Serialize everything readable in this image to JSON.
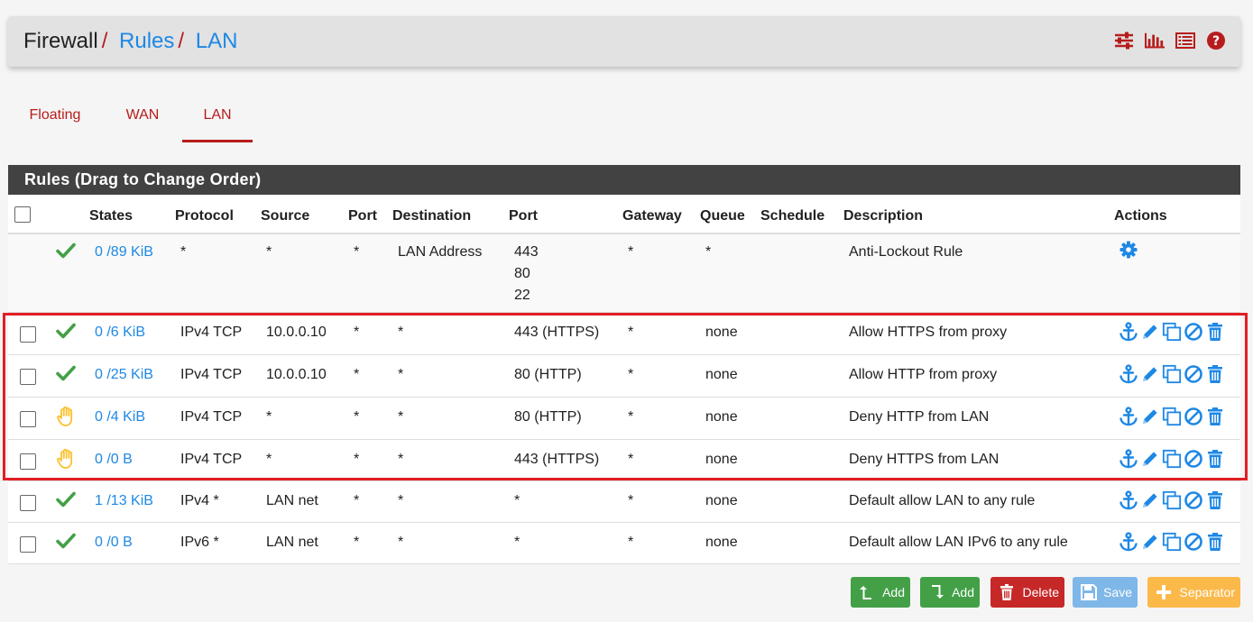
{
  "header": {
    "crumbs": [
      "Firewall",
      "Rules",
      "LAN"
    ],
    "separator": "/",
    "icons": [
      "sliders-icon",
      "bar-chart-icon",
      "list-icon",
      "help-icon"
    ]
  },
  "tabs": [
    "Floating",
    "WAN",
    "LAN"
  ],
  "active_tab": "LAN",
  "panel": {
    "title": "Rules (Drag to Change Order)"
  },
  "columns": [
    "States",
    "Protocol",
    "Source",
    "Port",
    "Destination",
    "Port",
    "Gateway",
    "Queue",
    "Schedule",
    "Description",
    "Actions"
  ],
  "rows": [
    {
      "status": "check",
      "states": "0 /89 KiB",
      "protocol": "*",
      "source": "*",
      "sport": "*",
      "destination": "LAN Address",
      "dport": [
        "443",
        "80",
        "22"
      ],
      "gateway": "*",
      "queue": "*",
      "schedule": "",
      "description": "Anti-Lockout Rule"
    },
    {
      "status": "check",
      "states": "0 /6 KiB",
      "protocol": "IPv4 TCP",
      "source": "10.0.0.10",
      "sport": "*",
      "destination": "*",
      "dport": [
        "443 (HTTPS)"
      ],
      "gateway": "*",
      "queue": "none",
      "schedule": "",
      "description": "Allow HTTPS from proxy"
    },
    {
      "status": "check",
      "states": "0 /25 KiB",
      "protocol": "IPv4 TCP",
      "source": "10.0.0.10",
      "sport": "*",
      "destination": "*",
      "dport": [
        "80 (HTTP)"
      ],
      "gateway": "*",
      "queue": "none",
      "schedule": "",
      "description": "Allow HTTP from proxy"
    },
    {
      "status": "hand",
      "states": "0 /4 KiB",
      "protocol": "IPv4 TCP",
      "source": "*",
      "sport": "*",
      "destination": "*",
      "dport": [
        "80 (HTTP)"
      ],
      "gateway": "*",
      "queue": "none",
      "schedule": "",
      "description": "Deny HTTP from LAN"
    },
    {
      "status": "hand",
      "states": "0 /0 B",
      "protocol": "IPv4 TCP",
      "source": "*",
      "sport": "*",
      "destination": "*",
      "dport": [
        "443 (HTTPS)"
      ],
      "gateway": "*",
      "queue": "none",
      "schedule": "",
      "description": "Deny HTTPS from LAN"
    },
    {
      "status": "check",
      "states": "1 /13 KiB",
      "protocol": "IPv4 *",
      "source": "LAN net",
      "sport": "*",
      "destination": "*",
      "dport": [
        "*"
      ],
      "gateway": "*",
      "queue": "none",
      "schedule": "",
      "description": "Default allow LAN to any rule"
    },
    {
      "status": "check",
      "states": "0 /0 B",
      "protocol": "IPv6 *",
      "source": "LAN net",
      "sport": "*",
      "destination": "*",
      "dport": [
        "*"
      ],
      "gateway": "*",
      "queue": "none",
      "schedule": "",
      "description": "Default allow LAN IPv6 to any rule"
    }
  ],
  "buttons": {
    "add_top": "Add",
    "add_bottom": "Add",
    "delete": "Delete",
    "save": "Save",
    "separator": "Separator"
  },
  "colors": {
    "accent_red": "#b71c1c",
    "link_blue": "#1e88e5",
    "pass_green": "#43a047",
    "block_yellow": "#fbc02d",
    "highlight_red": "#e31e24"
  }
}
